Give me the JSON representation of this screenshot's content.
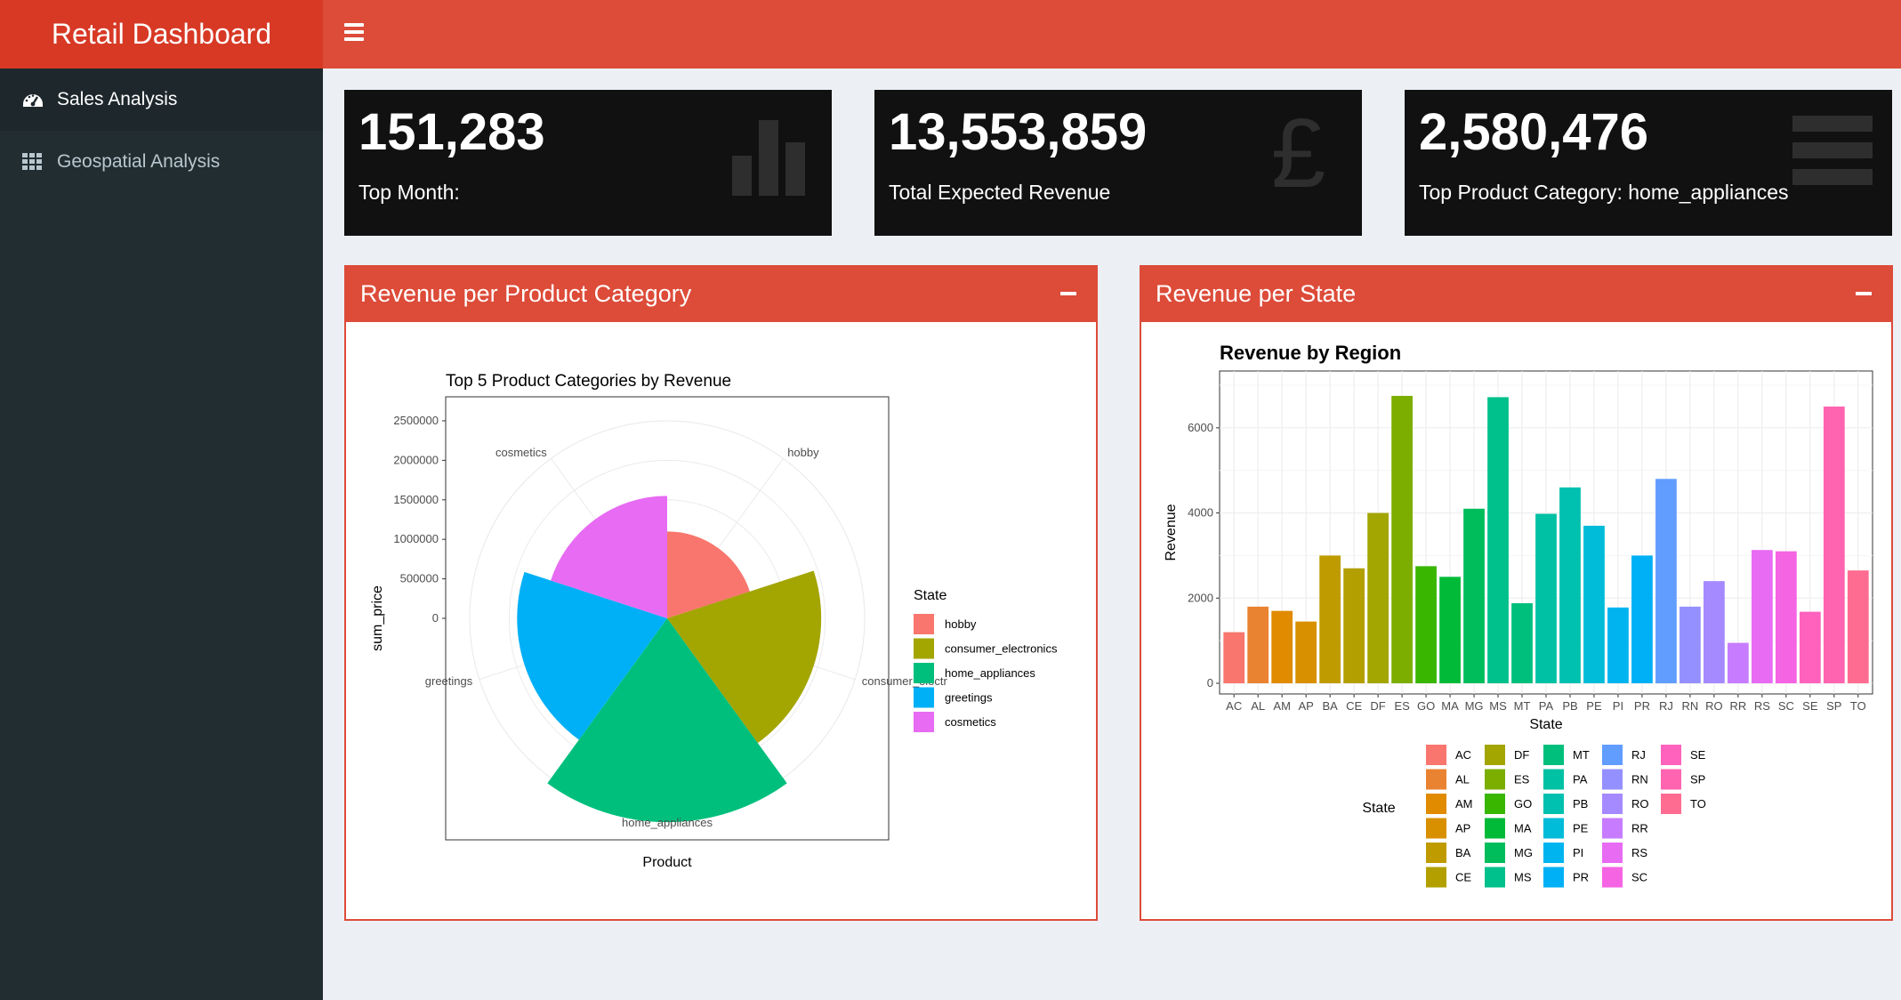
{
  "header": {
    "title": "Retail Dashboard"
  },
  "sidebar": {
    "items": [
      {
        "label": "Sales Analysis",
        "icon": "dashboard-icon",
        "active": true
      },
      {
        "label": "Geospatial Analysis",
        "icon": "grid-icon",
        "active": false
      }
    ]
  },
  "value_boxes": [
    {
      "value": "151,283",
      "subtitle": "Top Month:",
      "icon": "bar-chart-icon"
    },
    {
      "value": "13,553,859",
      "subtitle": "Total Expected Revenue",
      "icon": "pound-icon"
    },
    {
      "value": "2,580,476",
      "subtitle": "Top Product Category: home_appliances",
      "icon": "list-icon"
    }
  ],
  "panels": {
    "category": {
      "title": "Revenue per Product Category"
    },
    "state": {
      "title": "Revenue per State"
    }
  },
  "colors": {
    "header": "#dd4b39",
    "logo": "#d73925",
    "sidebar": "#222d32",
    "sidebar_active": "#1e282c"
  },
  "chart_data": [
    {
      "type": "polar-bar",
      "title": "Top 5 Product Categories by Revenue",
      "xlabel": "Product",
      "ylabel": "sum_price",
      "ylim": [
        0,
        2500000
      ],
      "y_ticks": [
        0,
        500000,
        1000000,
        1500000,
        2000000,
        2500000
      ],
      "categories": [
        "hobby",
        "consumer_electronics",
        "home_appliances",
        "greetings",
        "cosmetics"
      ],
      "category_labels": [
        "hobby",
        "consumer_electr",
        "home_appliances",
        "greetings",
        "cosmetics"
      ],
      "values": [
        1100000,
        1950000,
        2580476,
        1900000,
        1550000
      ],
      "colors": [
        "#F8766D",
        "#A3A500",
        "#00BF7D",
        "#00B0F6",
        "#E76BF3"
      ],
      "legend": {
        "title": "State",
        "position": "right"
      }
    },
    {
      "type": "bar",
      "title": "Revenue by Region",
      "xlabel": "State",
      "ylabel": "Revenue",
      "ylim": [
        0,
        7000
      ],
      "y_ticks": [
        0,
        2000,
        4000,
        6000
      ],
      "categories": [
        "AC",
        "AL",
        "AM",
        "AP",
        "BA",
        "CE",
        "DF",
        "ES",
        "GO",
        "MA",
        "MG",
        "MS",
        "MT",
        "PA",
        "PB",
        "PE",
        "PI",
        "PR",
        "RJ",
        "RN",
        "RO",
        "RR",
        "RS",
        "SC",
        "SE",
        "SP",
        "TO"
      ],
      "values": [
        1200,
        1800,
        1700,
        1450,
        3000,
        2700,
        4000,
        6750,
        2750,
        2500,
        4100,
        6720,
        1880,
        3980,
        4600,
        3700,
        1780,
        3000,
        4800,
        1800,
        2400,
        950,
        3130,
        3100,
        1680,
        6500,
        2650
      ],
      "colors": [
        "#F8766D",
        "#EA8331",
        "#E08B00",
        "#D89000",
        "#C09B00",
        "#B3A000",
        "#A3A500",
        "#7CAE00",
        "#39B600",
        "#00BA38",
        "#00BD5C",
        "#00C08B",
        "#00BF7D",
        "#00C1A3",
        "#00C0AF",
        "#00BCD8",
        "#00B4F0",
        "#00B0F6",
        "#619CFF",
        "#9590FF",
        "#A58AFF",
        "#C77CFF",
        "#E76BF3",
        "#F564E3",
        "#FF62BC",
        "#FF64B0",
        "#FF6C91"
      ],
      "legend": {
        "title": "State",
        "position": "bottom"
      }
    }
  ]
}
